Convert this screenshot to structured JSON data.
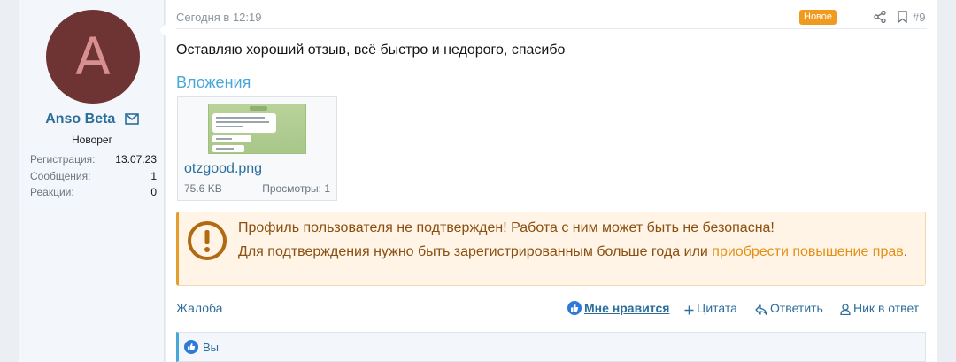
{
  "user": {
    "avatar_letter": "A",
    "username": "Anso Beta",
    "title": "Новорег",
    "stats": [
      {
        "label": "Регистрация:",
        "value": "13.07.23"
      },
      {
        "label": "Сообщения:",
        "value": "1"
      },
      {
        "label": "Реакции:",
        "value": "0"
      }
    ]
  },
  "post": {
    "date": "Сегодня в 12:19",
    "badge": "Новое",
    "number": "#9",
    "text": "Оставляю хороший отзыв, всё быстро и недорого, спасибо"
  },
  "attachments": {
    "title": "Вложения",
    "items": [
      {
        "name": "otzgood.png",
        "size": "75.6 KB",
        "views": "Просмотры: 1"
      }
    ]
  },
  "warning": {
    "line1": "Профиль пользователя не подтвержден! Работа с ним может быть не безопасна!",
    "line2": "Для подтверждения нужно быть зарегистрированным больше года или ",
    "link": "приобрести повышение прав",
    "tail": "."
  },
  "actions": {
    "report": "Жалоба",
    "like": "Мне нравится",
    "quote": "Цитата",
    "reply": "Ответить",
    "nick": "Ник в ответ"
  },
  "reactions": {
    "text": "Вы"
  },
  "colors": {
    "accent": "#2c6e9b",
    "badge": "#f09a1f",
    "warning_text": "#8a4f11",
    "warning_link": "#e39016"
  }
}
